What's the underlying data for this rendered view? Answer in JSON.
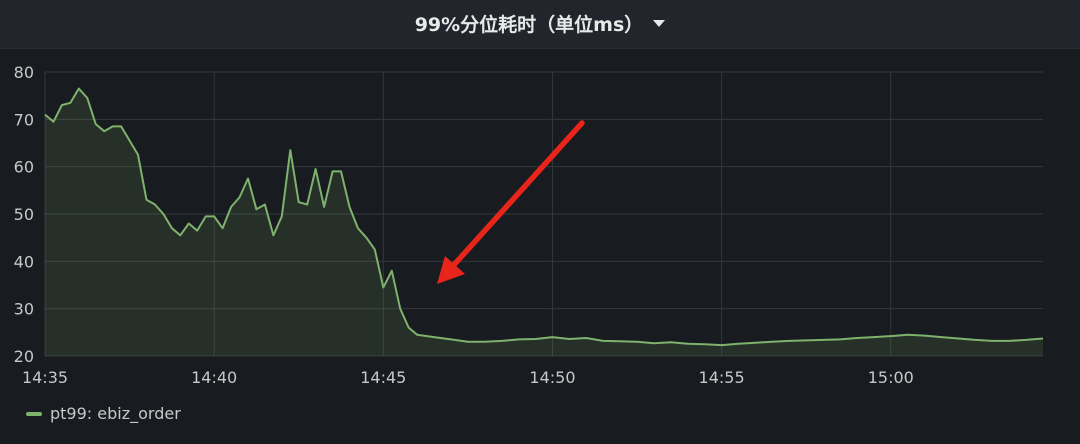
{
  "panel": {
    "title": "99%分位耗时（单位ms）",
    "menu_icon": "caret-down-icon"
  },
  "colors": {
    "background": "#181b1f",
    "header": "#22252b",
    "grid": "#34373c",
    "series": "#7eb26d",
    "series_fill": "rgba(126,178,109,0.14)",
    "annotation_arrow": "#e8251a"
  },
  "chart_data": {
    "type": "area",
    "grid": true,
    "legend_placement": "bottom-left",
    "xlabel": "",
    "ylabel": "",
    "x_range": [
      "14:35",
      "15:04.5"
    ],
    "ylim": [
      20,
      80
    ],
    "y_ticks": [
      20,
      30,
      40,
      50,
      60,
      70,
      80
    ],
    "x_ticks": [
      "14:35",
      "14:40",
      "14:45",
      "14:50",
      "14:55",
      "15:00"
    ],
    "series": [
      {
        "name": "pt99: ebiz_order",
        "x": [
          "14:35:00",
          "14:35:15",
          "14:35:30",
          "14:35:45",
          "14:36:00",
          "14:36:15",
          "14:36:30",
          "14:36:45",
          "14:37:00",
          "14:37:15",
          "14:37:30",
          "14:37:45",
          "14:38:00",
          "14:38:15",
          "14:38:30",
          "14:38:45",
          "14:39:00",
          "14:39:15",
          "14:39:30",
          "14:39:45",
          "14:40:00",
          "14:40:15",
          "14:40:30",
          "14:40:45",
          "14:41:00",
          "14:41:15",
          "14:41:30",
          "14:41:45",
          "14:42:00",
          "14:42:15",
          "14:42:30",
          "14:42:45",
          "14:43:00",
          "14:43:15",
          "14:43:30",
          "14:43:45",
          "14:44:00",
          "14:44:15",
          "14:44:30",
          "14:44:45",
          "14:45:00",
          "14:45:15",
          "14:45:30",
          "14:45:45",
          "14:46:00",
          "14:46:30",
          "14:47:00",
          "14:47:30",
          "14:48:00",
          "14:48:30",
          "14:49:00",
          "14:49:30",
          "14:50:00",
          "14:50:30",
          "14:51:00",
          "14:51:30",
          "14:52:00",
          "14:52:30",
          "14:53:00",
          "14:53:30",
          "14:54:00",
          "14:54:30",
          "14:55:00",
          "14:55:30",
          "14:56:00",
          "14:56:30",
          "14:57:00",
          "14:57:30",
          "14:58:00",
          "14:58:30",
          "14:59:00",
          "14:59:30",
          "15:00:00",
          "15:00:30",
          "15:01:00",
          "15:01:30",
          "15:02:00",
          "15:02:30",
          "15:03:00",
          "15:03:30",
          "15:04:00",
          "15:04:30"
        ],
        "values": [
          71,
          69.5,
          73,
          73.5,
          76.5,
          74.5,
          69,
          67.5,
          68.5,
          68.5,
          65.5,
          62.5,
          53,
          52,
          50,
          47,
          45.5,
          48,
          46.5,
          49.5,
          49.5,
          47,
          51.5,
          53.5,
          57.5,
          51,
          52,
          45.5,
          49.5,
          63.5,
          52.5,
          52,
          59.5,
          51.5,
          59,
          59,
          51.5,
          47,
          45,
          42.5,
          34.5,
          38,
          30,
          26,
          24.5,
          24,
          23.5,
          23,
          23,
          23.2,
          23.5,
          23.6,
          24,
          23.6,
          23.8,
          23.2,
          23.1,
          23,
          22.7,
          22.9,
          22.6,
          22.5,
          22.3,
          22.6,
          22.8,
          23,
          23.2,
          23.3,
          23.4,
          23.5,
          23.8,
          24,
          24.2,
          24.5,
          24.3,
          24,
          23.7,
          23.4,
          23.2,
          23.2,
          23.4,
          23.7
        ]
      }
    ]
  }
}
